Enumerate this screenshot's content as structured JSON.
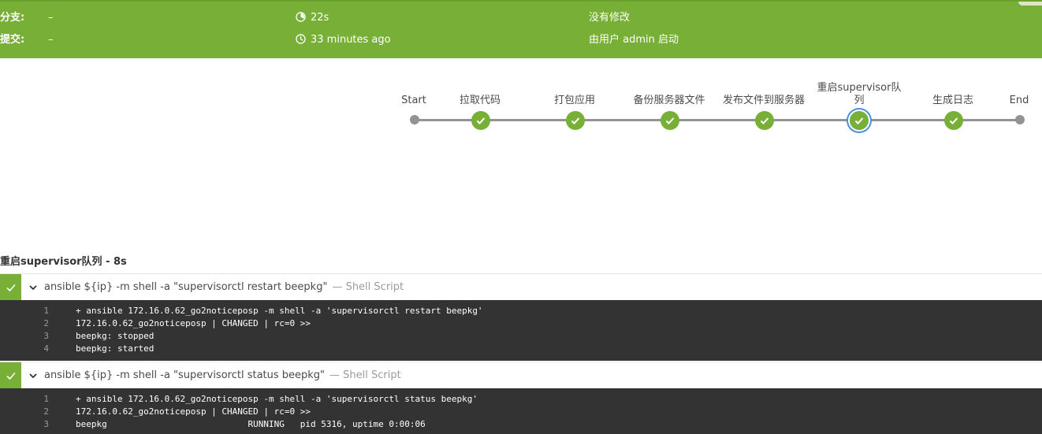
{
  "header": {
    "branch_label": "分支:",
    "branch_value": "–",
    "commit_label": "提交:",
    "commit_value": "–",
    "duration": "22s",
    "started_ago": "33 minutes ago",
    "changes": "没有修改",
    "started_by": "由用户 admin 启动",
    "duration_icon": "timer-icon",
    "time_icon": "clock-icon",
    "accent": "#78b037"
  },
  "pipeline": {
    "start": "Start",
    "end": "End",
    "stages": [
      {
        "label": "拉取代码",
        "status": "success"
      },
      {
        "label": "打包应用",
        "status": "success"
      },
      {
        "label": "备份服务器文件",
        "status": "success"
      },
      {
        "label": "发布文件到服务器",
        "status": "success"
      },
      {
        "label": "重启supervisor队列",
        "status": "success",
        "selected": true
      },
      {
        "label": "生成日志",
        "status": "success"
      }
    ]
  },
  "log": {
    "title": "重启supervisor队列 - 8s",
    "steps": [
      {
        "command": "ansible ${ip} -m shell -a \"supervisorctl restart beepkg\"",
        "type": "— Shell Script",
        "lines": [
          {
            "n": "1",
            "text": "+ ansible 172.16.0.62_go2noticeposp -m shell -a 'supervisorctl restart beepkg'"
          },
          {
            "n": "2",
            "text": "172.16.0.62_go2noticeposp | CHANGED | rc=0 >>"
          },
          {
            "n": "3",
            "text": "beepkg: stopped"
          },
          {
            "n": "4",
            "text": "beepkg: started"
          }
        ]
      },
      {
        "command": "ansible ${ip} -m shell -a \"supervisorctl status beepkg\"",
        "type": "— Shell Script",
        "lines": [
          {
            "n": "1",
            "text": "+ ansible 172.16.0.62_go2noticeposp -m shell -a 'supervisorctl status beepkg'"
          },
          {
            "n": "2",
            "text": "172.16.0.62_go2noticeposp | CHANGED | rc=0 >>"
          },
          {
            "n": "3",
            "text": "beepkg                           RUNNING   pid 5316, uptime 0:00:06"
          }
        ]
      }
    ]
  }
}
